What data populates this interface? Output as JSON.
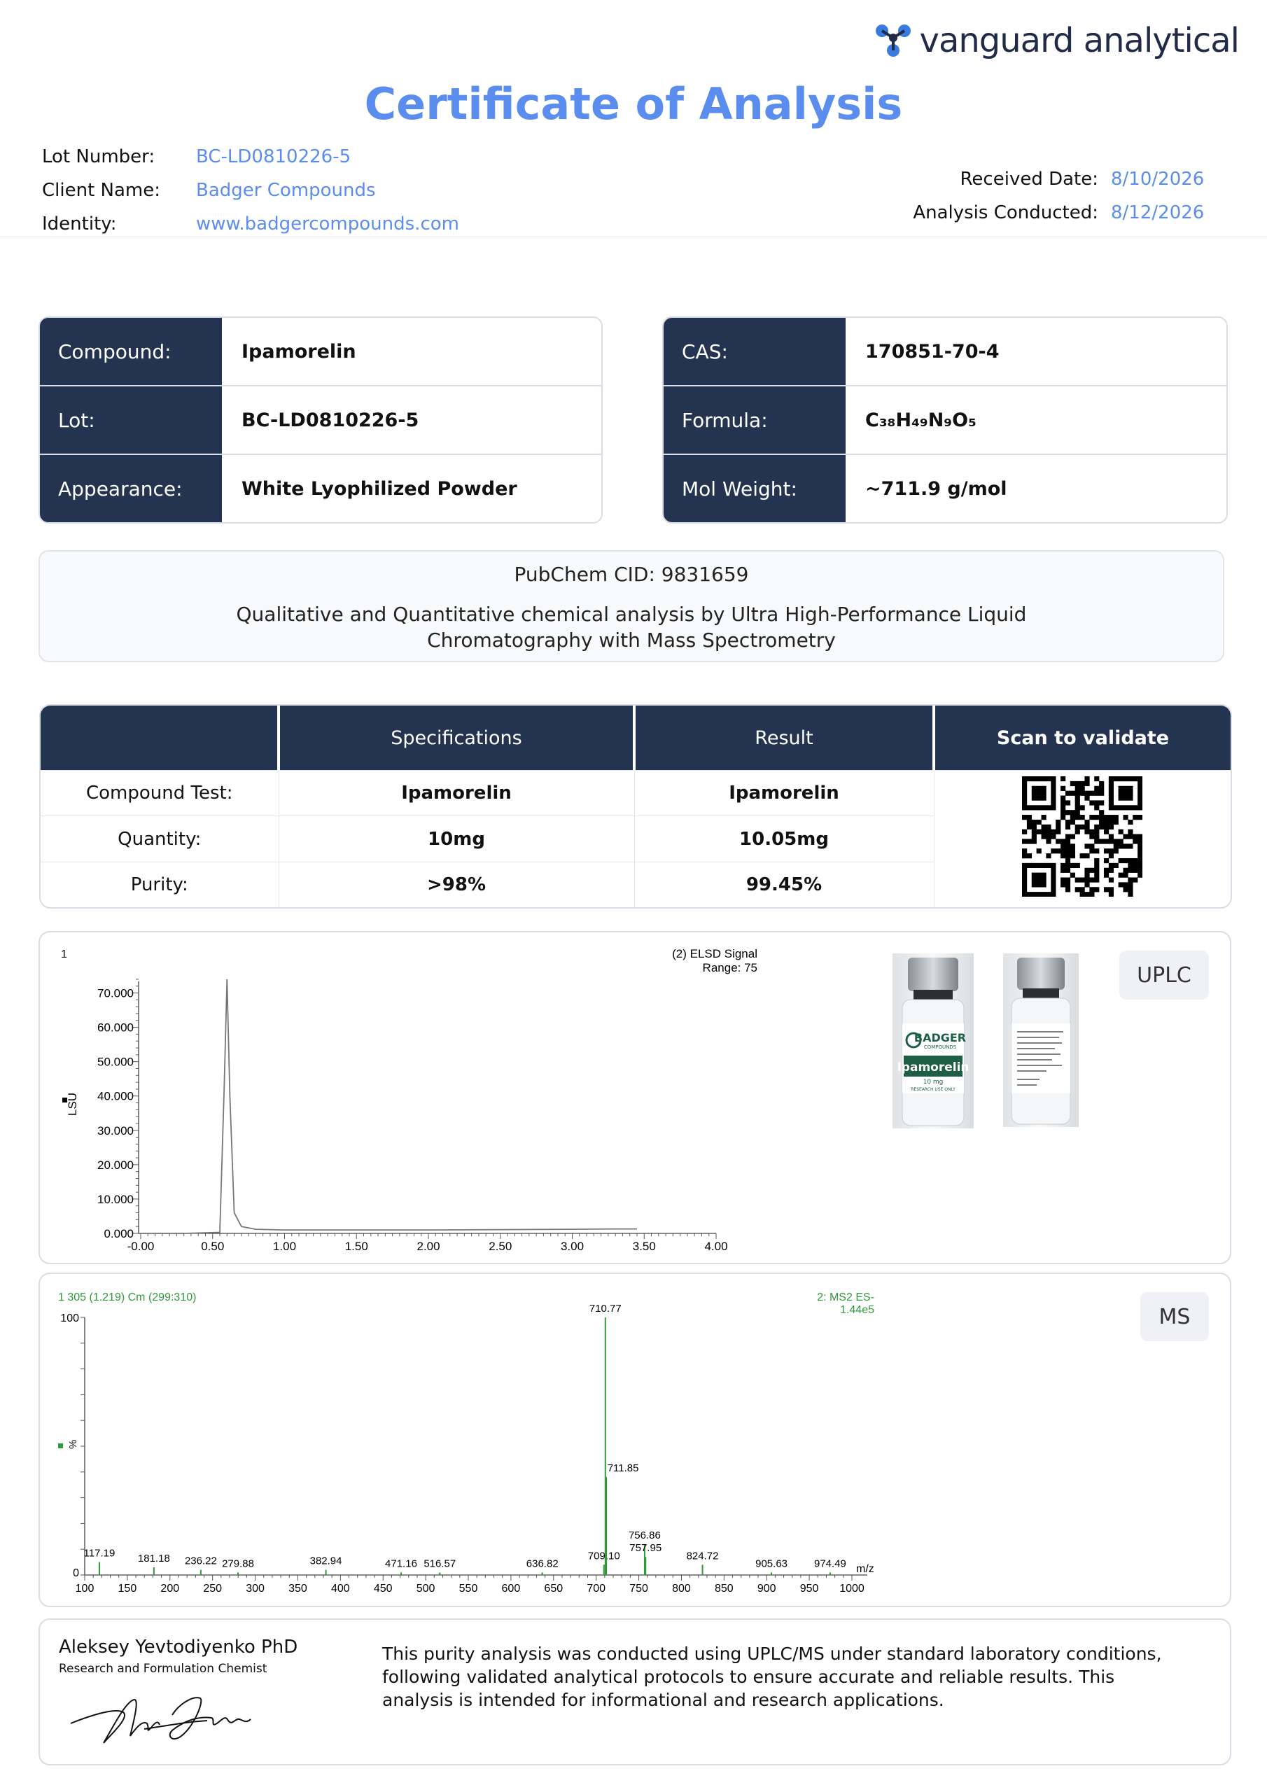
{
  "brand": {
    "name": "vanguard analytical"
  },
  "title": "Certificate of Analysis",
  "header": {
    "lot_number_label": "Lot Number:",
    "lot_number": "BC-LD0810226-5",
    "client_label": "Client Name:",
    "client": "Badger Compounds",
    "identity_label": "Identity:",
    "identity": "www.badgercompounds.com",
    "received_label": "Received Date:",
    "received": "8/10/2026",
    "analysis_label": "Analysis Conducted:",
    "analysis": "8/12/2026"
  },
  "compound_box": [
    {
      "label": "Compound:",
      "value": "Ipamorelin"
    },
    {
      "label": "Lot:",
      "value": "BC-LD0810226-5"
    },
    {
      "label": "Appearance:",
      "value": "White Lyophilized Powder"
    }
  ],
  "chem_box": [
    {
      "label": "CAS:",
      "value": "170851-70-4"
    },
    {
      "label": "Formula:",
      "value": "C₃₈H₄₉N₉O₅"
    },
    {
      "label": "Mol Weight:",
      "value": "~711.9 g/mol"
    }
  ],
  "pubchem": {
    "cid": "PubChem CID: 9831659",
    "method_line1": "Qualitative and Quantitative chemical analysis by Ultra High-Performance Liquid",
    "method_line2": "Chromatography with Mass Spectrometry"
  },
  "results": {
    "headers": [
      "",
      "Specifications",
      "Result",
      "Scan to validate"
    ],
    "rows": [
      {
        "test": "Compound Test:",
        "spec": "Ipamorelin",
        "result": "Ipamorelin"
      },
      {
        "test": "Quantity:",
        "spec": "10mg",
        "result": "10.05mg"
      },
      {
        "test": "Purity:",
        "spec": ">98%",
        "result": "99.45%"
      }
    ]
  },
  "uplc": {
    "tag": "UPLC",
    "corner": "1",
    "signal_line1": "(2) ELSD Signal",
    "signal_line2": "Range: 75",
    "ylabel": "LSU",
    "vial_brand": "BADGER",
    "vial_brand_sub": "COMPOUNDS",
    "vial_product": "Ipamorelin",
    "vial_dose": "10 mg",
    "vial_use": "RESEARCH USE ONLY"
  },
  "ms": {
    "tag": "MS",
    "scan_info": "1 305 (1.219) Cm (299:310)",
    "channel_line1": "2: MS2 ES-",
    "channel_line2": "1.44e5",
    "ylabel": "%",
    "xlabel": "m/z"
  },
  "chart_data": [
    {
      "type": "line",
      "title": "(2) ELSD Signal",
      "ylabel": "LSU",
      "xlim": [
        0,
        4
      ],
      "ylim": [
        0,
        75
      ],
      "x_ticks": [
        "-0.00",
        "0.50",
        "1.00",
        "1.50",
        "2.00",
        "2.50",
        "3.00",
        "3.50",
        "4.00"
      ],
      "y_ticks": [
        "0.000",
        "10.000",
        "20.000",
        "30.000",
        "40.000",
        "50.000",
        "60.000",
        "70.000"
      ],
      "series": [
        {
          "x": [
            0.0,
            0.3,
            0.55,
            0.58,
            0.6,
            0.62,
            0.65,
            0.7,
            0.8,
            1.0,
            1.5,
            2.0,
            2.5,
            3.0,
            3.3,
            3.45
          ],
          "y": [
            0.0,
            0.0,
            0.3,
            42.0,
            74.0,
            40.0,
            6.0,
            2.0,
            1.2,
            1.0,
            1.0,
            1.0,
            1.1,
            1.2,
            1.3,
            1.3
          ]
        }
      ]
    },
    {
      "type": "bar",
      "xlabel": "m/z",
      "ylabel": "%",
      "xlim": [
        100,
        1000
      ],
      "ylim": [
        0,
        100
      ],
      "x_ticks": [
        "100",
        "150",
        "200",
        "250",
        "300",
        "350",
        "400",
        "450",
        "500",
        "550",
        "600",
        "650",
        "700",
        "750",
        "800",
        "850",
        "900",
        "950",
        "1000"
      ],
      "y_ticks": [
        "0",
        "100"
      ],
      "peaks": [
        {
          "mz": 117.19,
          "intensity": 5,
          "label": "117.19"
        },
        {
          "mz": 181.18,
          "intensity": 3,
          "label": "181.18"
        },
        {
          "mz": 236.22,
          "intensity": 2,
          "label": "236.22"
        },
        {
          "mz": 279.88,
          "intensity": 1,
          "label": "279.88"
        },
        {
          "mz": 382.94,
          "intensity": 2,
          "label": "382.94"
        },
        {
          "mz": 471.16,
          "intensity": 1,
          "label": "471.16"
        },
        {
          "mz": 516.57,
          "intensity": 1,
          "label": "516.57"
        },
        {
          "mz": 636.82,
          "intensity": 1,
          "label": "636.82"
        },
        {
          "mz": 709.1,
          "intensity": 4,
          "label": "709.10"
        },
        {
          "mz": 710.77,
          "intensity": 100,
          "label": "710.77"
        },
        {
          "mz": 711.85,
          "intensity": 38,
          "label": "711.85"
        },
        {
          "mz": 756.86,
          "intensity": 12,
          "label": "756.86"
        },
        {
          "mz": 757.95,
          "intensity": 7,
          "label": "757.95"
        },
        {
          "mz": 824.72,
          "intensity": 4,
          "label": "824.72"
        },
        {
          "mz": 905.63,
          "intensity": 1,
          "label": "905.63"
        },
        {
          "mz": 974.49,
          "intensity": 1,
          "label": "974.49"
        }
      ]
    }
  ],
  "signer": {
    "name": "Aleksey Yevtodiyenko PhD",
    "role": "Research and Formulation Chemist",
    "note": "This purity analysis was conducted using UPLC/MS under standard laboratory conditions, following validated analytical protocols to ensure accurate and reliable results. This analysis is intended for informational and research applications."
  },
  "colors": {
    "accent": "#5b8def",
    "navy": "#243450",
    "ms_green": "#2e9a3a"
  }
}
